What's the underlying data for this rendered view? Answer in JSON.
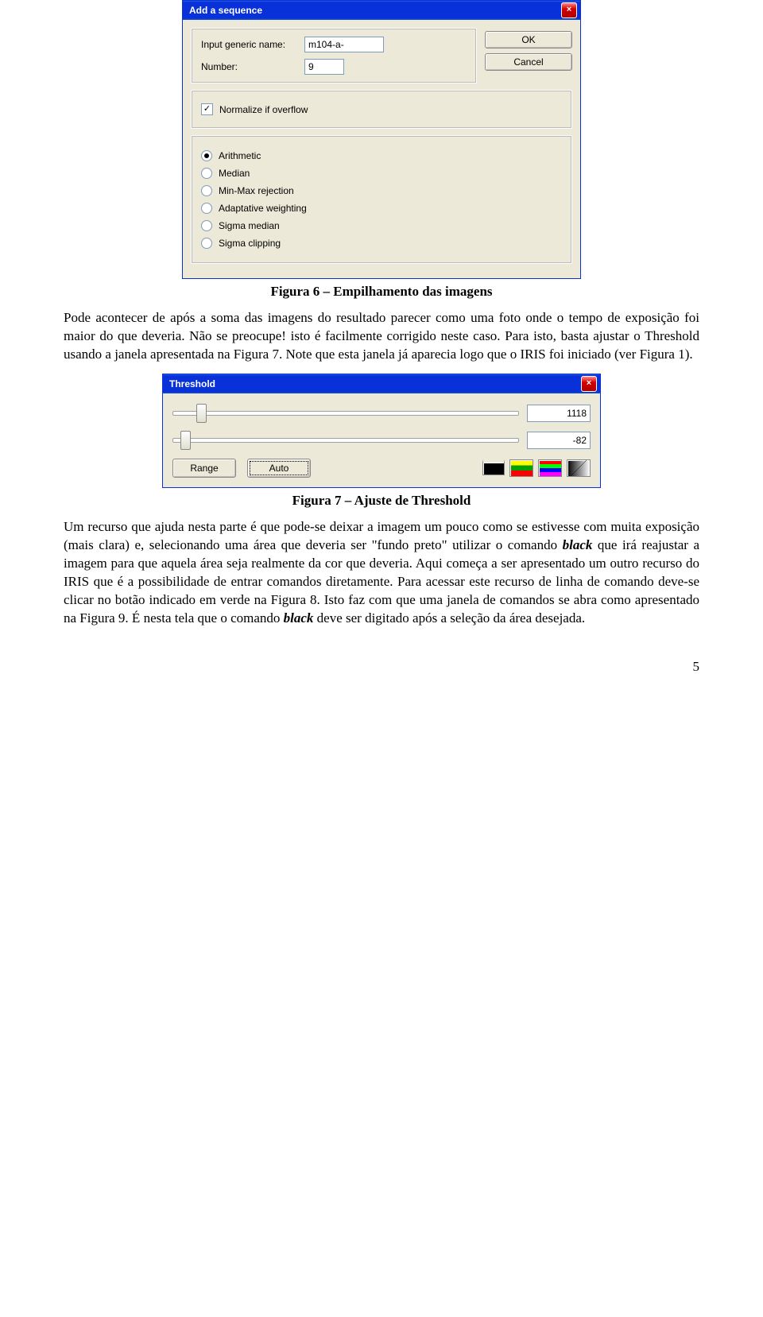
{
  "dialog1": {
    "title": "Add a sequence",
    "ok_label": "OK",
    "cancel_label": "Cancel",
    "input_name_label": "Input generic name:",
    "input_name_value": "m104-a-",
    "number_label": "Number:",
    "number_value": "9",
    "normalize_label": "Normalize if overflow",
    "normalize_checked": true,
    "radios": [
      {
        "label": "Arithmetic",
        "selected": true
      },
      {
        "label": "Median",
        "selected": false
      },
      {
        "label": "Min-Max rejection",
        "selected": false
      },
      {
        "label": "Adaptative weighting",
        "selected": false
      },
      {
        "label": "Sigma median",
        "selected": false
      },
      {
        "label": "Sigma clipping",
        "selected": false
      }
    ]
  },
  "caption1": "Figura 6 – Empilhamento das imagens",
  "para1": "Pode acontecer de após a soma das imagens do resultado parecer como uma foto onde o tempo de exposição foi maior do que deveria. Não se preocupe! isto é facilmente corrigido neste caso. Para isto, basta ajustar o Threshold usando a janela apresentada na Figura 7. Note que esta janela já aparecia logo que o IRIS foi iniciado (ver Figura 1).",
  "dialog2": {
    "title": "Threshold",
    "value_high": "1118",
    "value_low": "-82",
    "range_label": "Range",
    "auto_label": "Auto"
  },
  "caption2": "Figura 7 – Ajuste de Threshold",
  "para2_a": "Um recurso que ajuda nesta parte é que pode-se deixar a imagem um pouco como se estivesse com muita exposição (mais clara) e, selecionando uma área que deveria ser \"fundo preto\" utilizar o comando ",
  "black1": "black",
  "para2_b": " que irá reajustar a imagem para que aquela área seja realmente da cor que deveria. Aqui começa a ser apresentado um outro recurso do IRIS que é a possibilidade de entrar comandos diretamente. Para acessar este recurso de linha de comando deve-se clicar no botão indicado em verde na Figura 8. Isto faz com que uma janela de comandos se abra como apresentado na Figura 9. É nesta tela que o comando ",
  "black2": "black",
  "para2_c": " deve ser digitado após a seleção da área desejada.",
  "page_number": "5"
}
